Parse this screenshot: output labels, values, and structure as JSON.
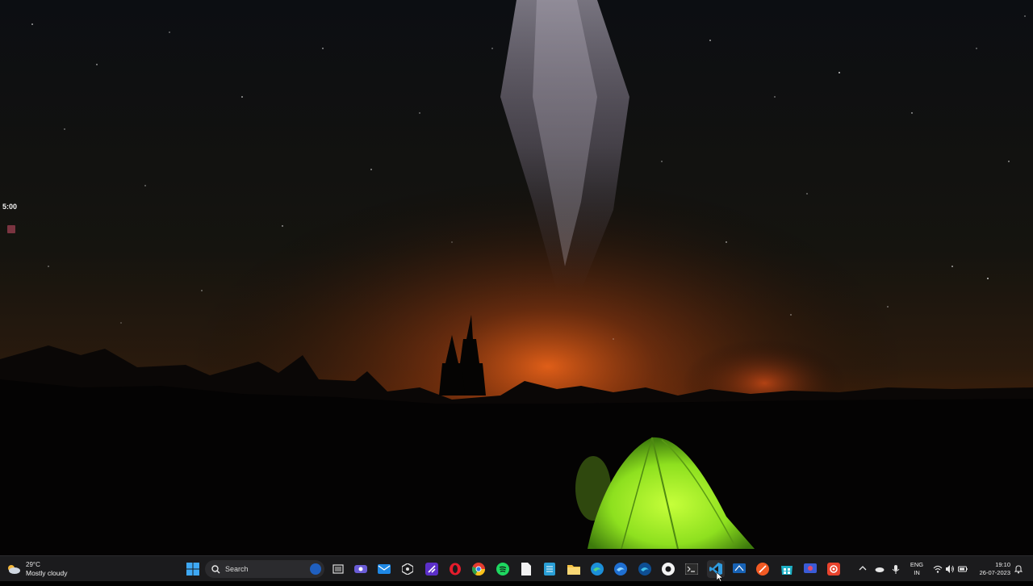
{
  "desktop": {
    "timer_widget": {
      "time": "5:00"
    }
  },
  "taskbar": {
    "weather": {
      "temperature": "29°C",
      "condition": "Mostly cloudy",
      "icon": "cloudy-icon"
    },
    "start": {
      "icon": "windows-start-icon"
    },
    "search": {
      "placeholder": "Search",
      "icon": "search-icon"
    },
    "pinned_apps": [
      {
        "name": "task-view",
        "icon": "task-view-icon"
      },
      {
        "name": "teams-meet",
        "icon": "video-camera-icon"
      },
      {
        "name": "mail",
        "icon": "mail-icon"
      },
      {
        "name": "unity",
        "icon": "unity-icon"
      },
      {
        "name": "visual-studio",
        "icon": "visual-studio-icon"
      },
      {
        "name": "opera",
        "icon": "opera-icon"
      },
      {
        "name": "chrome",
        "icon": "chrome-icon"
      },
      {
        "name": "spotify",
        "icon": "spotify-icon"
      },
      {
        "name": "notepad",
        "icon": "document-icon"
      },
      {
        "name": "calculator-app",
        "icon": "calendar-grid-icon"
      },
      {
        "name": "file-explorer",
        "icon": "folder-icon"
      },
      {
        "name": "edge",
        "icon": "edge-icon"
      },
      {
        "name": "edge-beta",
        "icon": "edge-beta-icon"
      },
      {
        "name": "edge-dev",
        "icon": "edge-dev-icon"
      },
      {
        "name": "obs",
        "icon": "circle-app-icon"
      },
      {
        "name": "terminal",
        "icon": "terminal-icon"
      },
      {
        "name": "vscode",
        "icon": "vscode-icon"
      },
      {
        "name": "remote-desktop",
        "icon": "remote-desktop-icon"
      },
      {
        "name": "brave",
        "icon": "brave-icon"
      },
      {
        "name": "store",
        "icon": "store-icon"
      },
      {
        "name": "snipping",
        "icon": "snipping-icon"
      },
      {
        "name": "settings-app",
        "icon": "settings-app-icon"
      }
    ],
    "tray": {
      "language": "ENG",
      "region": "IN",
      "time": "19:10",
      "date": "26-07-2023"
    }
  },
  "colors": {
    "taskbar_bg": "#1b1b1d",
    "tent": "#8ee01f",
    "horizon_glow": "#ff6a1a"
  }
}
